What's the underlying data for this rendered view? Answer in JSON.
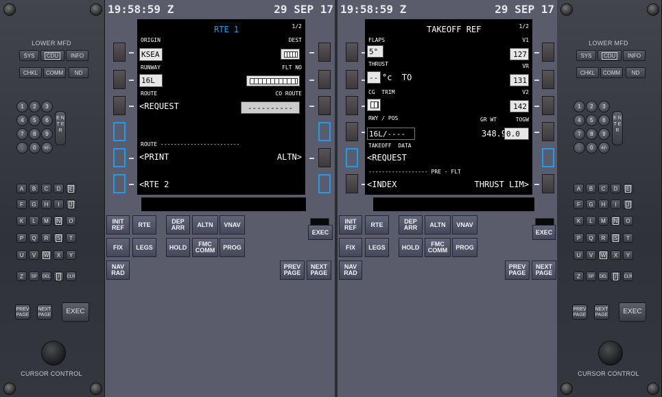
{
  "left_panel": {
    "title": "LOWER MFD",
    "mode_buttons": [
      "SYS",
      "CDU",
      "INFO"
    ],
    "mode_buttons2": [
      "CHKL",
      "COMM",
      "ND"
    ],
    "number_keys": [
      "1",
      "2",
      "3",
      "4",
      "5",
      "6",
      "7",
      "8",
      "9",
      ".",
      "0",
      "+/-"
    ],
    "enter_label": "E N T E R",
    "letter_keys": [
      "A",
      "B",
      "C",
      "D",
      "E",
      "F",
      "G",
      "H",
      "I",
      "J",
      "K",
      "L",
      "M",
      "N",
      "O",
      "P",
      "Q",
      "R",
      "S",
      "T",
      "U",
      "V",
      "W",
      "X",
      "Y",
      "Z",
      "SP",
      "DEL",
      "/",
      "CLR"
    ],
    "prev_page": "PREV PAGE",
    "next_page": "NEXT PAGE",
    "exec": "EXEC",
    "cursor_control": "CURSOR CONTROL"
  },
  "right_panel": {
    "title": "LOWER MFD",
    "mode_buttons": [
      "SYS",
      "CDU",
      "INFO"
    ],
    "mode_buttons2": [
      "CHKL",
      "COMM",
      "ND"
    ],
    "number_keys": [
      "1",
      "2",
      "3",
      "4",
      "5",
      "6",
      "7",
      "8",
      "9",
      ".",
      "0",
      "+/-"
    ],
    "enter_label": "E N T E R",
    "letter_keys": [
      "A",
      "B",
      "C",
      "D",
      "E",
      "F",
      "G",
      "H",
      "I",
      "J",
      "K",
      "L",
      "M",
      "N",
      "O",
      "P",
      "Q",
      "R",
      "S",
      "T",
      "U",
      "V",
      "W",
      "X",
      "Y",
      "Z",
      "SP",
      "DEL",
      "/",
      "CLR"
    ],
    "prev_page": "PREV PAGE",
    "next_page": "NEXT PAGE",
    "exec": "EXEC",
    "cursor_control": "CURSOR CONTROL"
  },
  "cdu_left": {
    "time": "19:58:59 Z",
    "date": "29 SEP 17",
    "page_title": "RTE 1",
    "page_num": "1/2",
    "lines": {
      "origin_label": "ORIGIN",
      "origin_value": "KSEA",
      "dest_label": "DEST",
      "runway_label": "RUNWAY",
      "runway_value": "16L",
      "flt_no_label": "FLT NO",
      "route_label": "ROUTE",
      "co_route_label": "CO ROUTE",
      "request": "<REQUEST",
      "co_route_value": "----------",
      "route_sep": "ROUTE ------------------------",
      "print": "<PRINT",
      "altn": "ALTN>",
      "rte2": "<RTE 2"
    }
  },
  "cdu_right": {
    "time": "19:58:59 Z",
    "date": "29 SEP 17",
    "page_title": "TAKEOFF REF",
    "page_num": "1/2",
    "lines": {
      "flaps_label": "FLAPS",
      "flaps_value": "5°",
      "v1_label": "V1",
      "v1_value": "127",
      "thrust_label": "THRUST",
      "thrust_value": "--",
      "thrust_unit": "°c  TO",
      "vr_label": "VR",
      "vr_value": "131",
      "cg_trim_label": "CG  TRIM",
      "v2_label": "V2",
      "v2_value": "142",
      "rwy_pos_label": "RWY / POS",
      "gr_wt_label": "GR WT",
      "togw_label": "TOGW",
      "rwy_pos_value": "16L/----",
      "gr_wt_value": "348.9",
      "togw_value": "0.0",
      "takeoff_data_label": "TAKEOFF  DATA",
      "request": "<REQUEST",
      "preflt_sep": "------------------ PRE - FLT",
      "index": "<INDEX",
      "thrust_lim": "THRUST LIM>"
    }
  },
  "function_keys": {
    "row1": [
      "INIT REF",
      "RTE",
      "DEP ARR",
      "ALTN",
      "VNAV"
    ],
    "row2": [
      "FIX",
      "LEGS",
      "HOLD",
      "FMC COMM",
      "PROG"
    ],
    "row3": [
      "NAV RAD"
    ],
    "exec": "EXEC",
    "prev_page": "PREV PAGE",
    "next_page": "NEXT PAGE"
  },
  "colors": {
    "title_blue": "#1d9cf0",
    "screen_bg": "#000000",
    "panel_bg": "#5a5c6b"
  }
}
